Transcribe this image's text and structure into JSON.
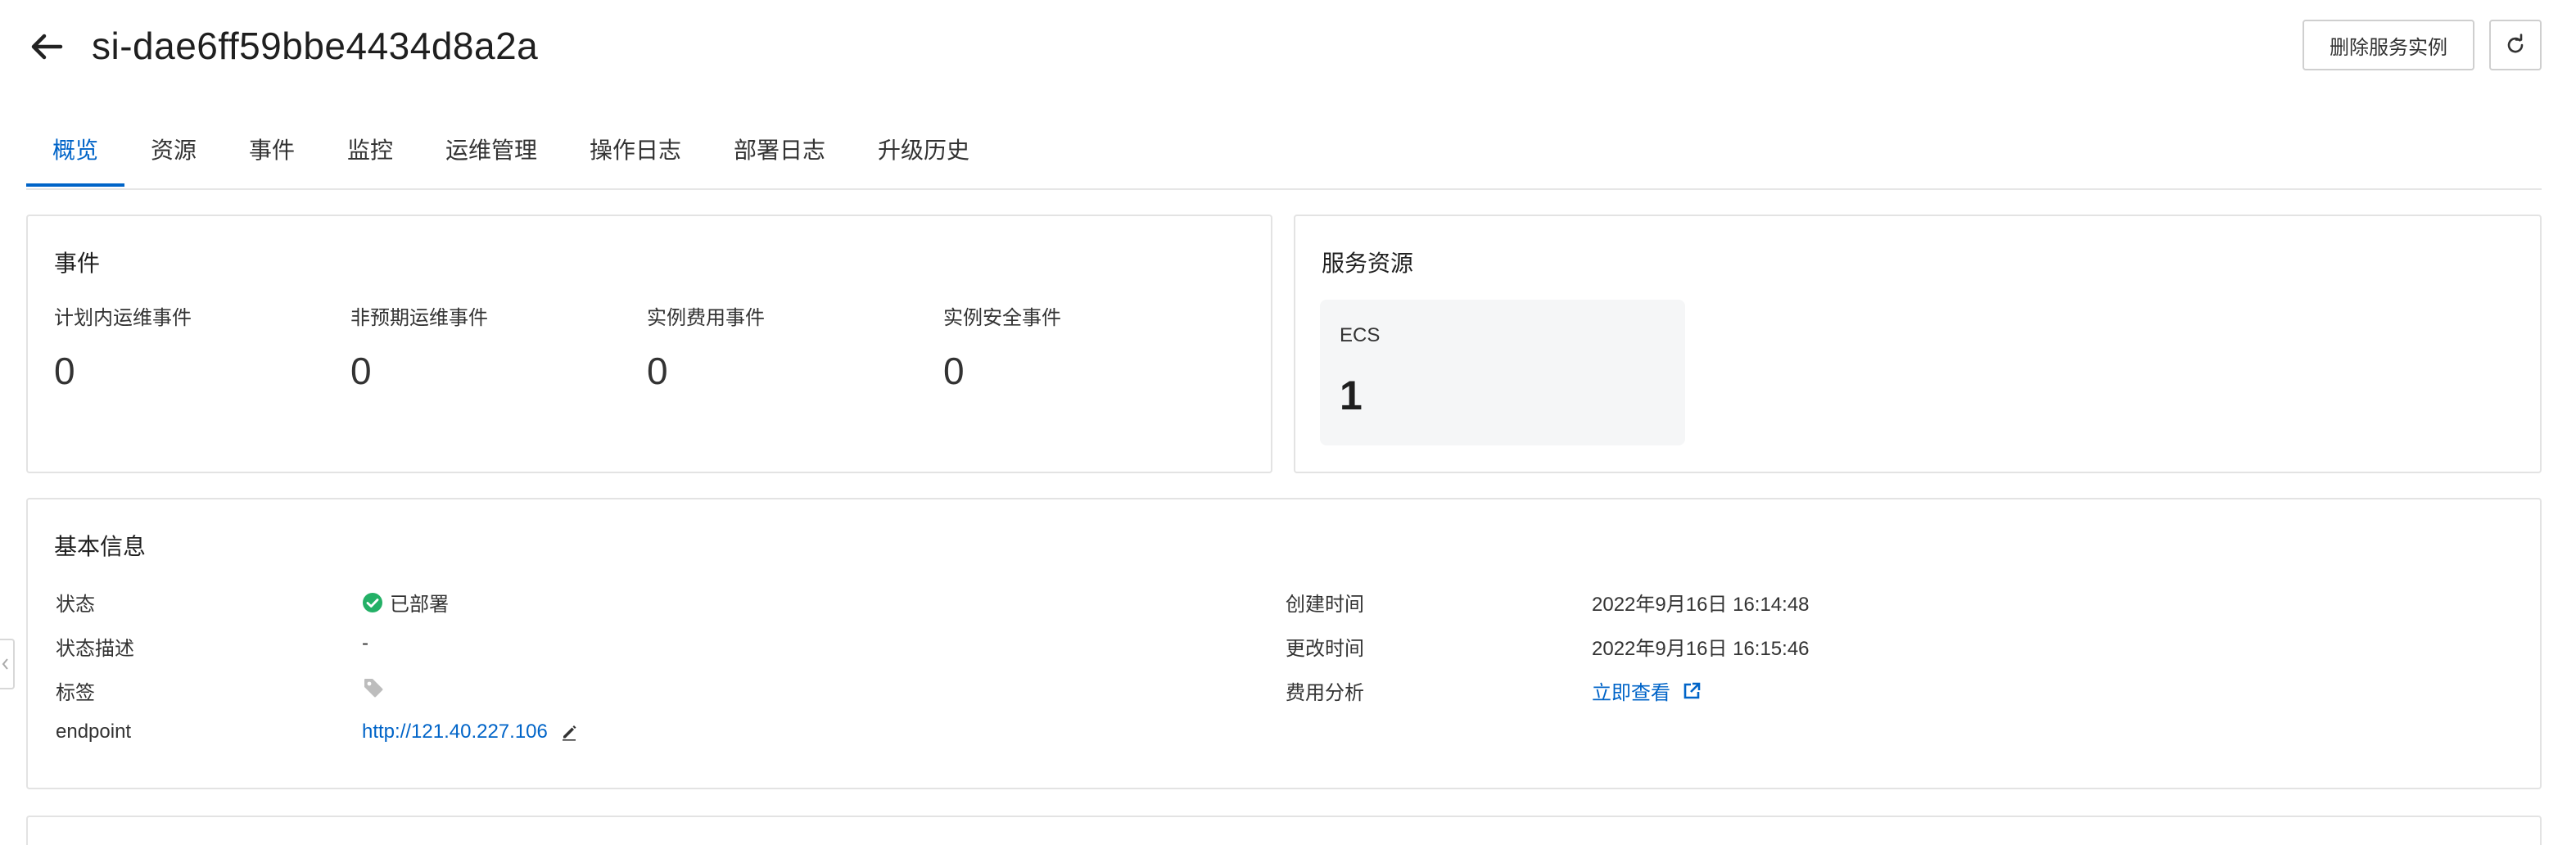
{
  "header": {
    "title": "si-dae6ff59bbe4434d8a2a",
    "delete_label": "删除服务实例"
  },
  "tabs": [
    {
      "label": "概览",
      "active": true
    },
    {
      "label": "资源"
    },
    {
      "label": "事件"
    },
    {
      "label": "监控"
    },
    {
      "label": "运维管理"
    },
    {
      "label": "操作日志"
    },
    {
      "label": "部署日志"
    },
    {
      "label": "升级历史"
    }
  ],
  "events": {
    "title": "事件",
    "items": [
      {
        "label": "计划内运维事件",
        "value": "0"
      },
      {
        "label": "非预期运维事件",
        "value": "0"
      },
      {
        "label": "实例费用事件",
        "value": "0"
      },
      {
        "label": "实例安全事件",
        "value": "0"
      }
    ]
  },
  "service_resources": {
    "title": "服务资源",
    "ecs_label": "ECS",
    "ecs_count": "1"
  },
  "basic_info": {
    "title": "基本信息",
    "status_label": "状态",
    "status_value": "已部署",
    "status_desc_label": "状态描述",
    "status_desc_value": "-",
    "tags_label": "标签",
    "endpoint_label": "endpoint",
    "endpoint_value": "http://121.40.227.106",
    "created_label": "创建时间",
    "created_value": "2022年9月16日 16:14:48",
    "modified_label": "更改时间",
    "modified_value": "2022年9月16日 16:15:46",
    "cost_label": "费用分析",
    "cost_link": "立即查看"
  },
  "colors": {
    "accent": "#0064c8",
    "success": "#23b066",
    "border": "#e3e3e3"
  },
  "icons": [
    "arrow-left-icon",
    "refresh-icon",
    "check-circle-icon",
    "tag-icon",
    "edit-icon",
    "external-link-icon",
    "chevron-left-icon"
  ]
}
